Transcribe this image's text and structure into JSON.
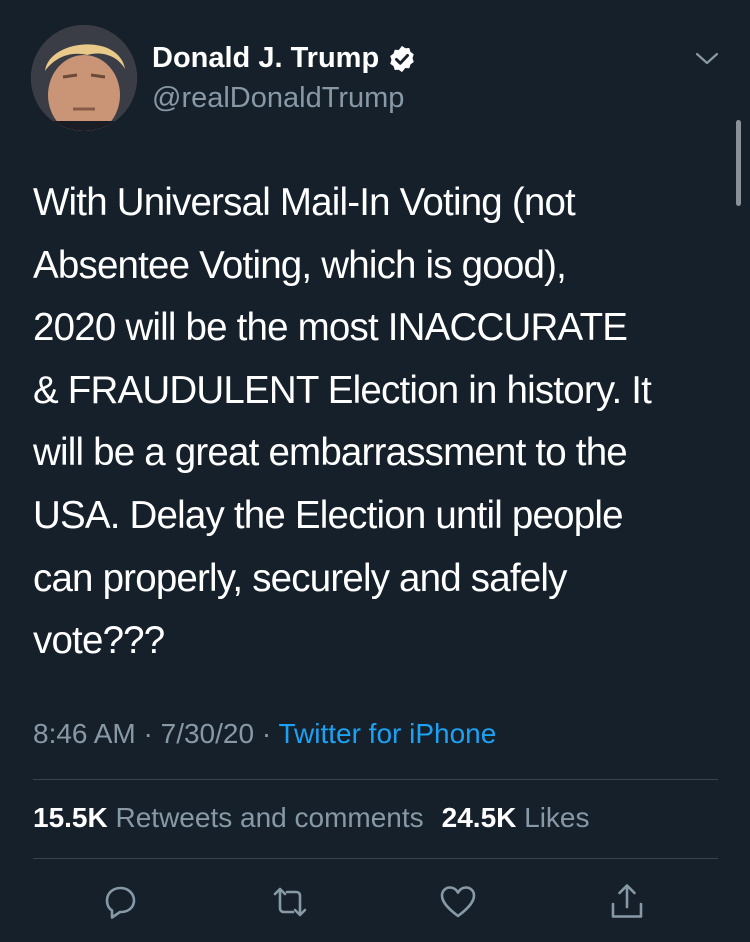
{
  "author": {
    "display_name": "Donald J. Trump",
    "handle": "@realDonaldTrump",
    "verified": true,
    "avatar_icon": "profile-photo"
  },
  "tweet": {
    "text": "With Universal Mail-In Voting (not\nAbsentee Voting, which is good),\n2020 will be the most INACCURATE\n& FRAUDULENT Election in history. It\nwill be a great embarrassment to the\nUSA. Delay the Election until people\ncan properly, securely and safely\nvote???"
  },
  "meta": {
    "time": "8:46 AM",
    "separator": " · ",
    "date": "7/30/20",
    "source": "Twitter for iPhone"
  },
  "stats": {
    "retweets_count": "15.5K",
    "retweets_label": "Retweets and comments",
    "likes_count": "24.5K",
    "likes_label": "Likes"
  },
  "actions": {
    "reply_icon": "reply-icon",
    "retweet_icon": "retweet-icon",
    "like_icon": "like-icon",
    "share_icon": "share-icon"
  },
  "colors": {
    "background": "#15202b",
    "text": "#ffffff",
    "muted": "#8899a6",
    "link": "#1da1f2",
    "divider": "#38444d"
  }
}
